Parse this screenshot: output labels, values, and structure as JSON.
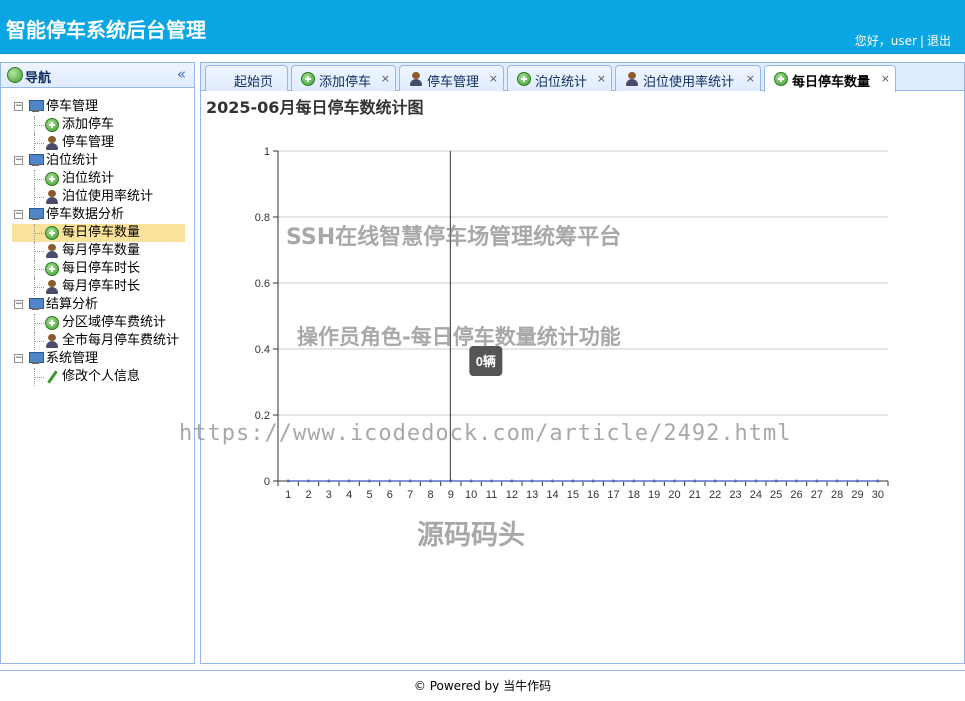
{
  "header": {
    "title": "智能停车系统后台管理",
    "greeting": "您好，user",
    "separator": "|",
    "logout": "退出"
  },
  "nav": {
    "title": "导航",
    "collapse": "«",
    "tree": [
      {
        "label": "停车管理",
        "icon": "computer-icon",
        "children": [
          {
            "label": "添加停车",
            "icon": "add-icon"
          },
          {
            "label": "停车管理",
            "icon": "user-icon"
          }
        ]
      },
      {
        "label": "泊位统计",
        "icon": "computer-icon",
        "children": [
          {
            "label": "泊位统计",
            "icon": "add-icon"
          },
          {
            "label": "泊位使用率统计",
            "icon": "user-icon"
          }
        ]
      },
      {
        "label": "停车数据分析",
        "icon": "computer-icon",
        "children": [
          {
            "label": "每日停车数量",
            "icon": "add-icon",
            "selected": true
          },
          {
            "label": "每月停车数量",
            "icon": "user-icon"
          },
          {
            "label": "每日停车时长",
            "icon": "add-icon"
          },
          {
            "label": "每月停车时长",
            "icon": "user-icon"
          }
        ]
      },
      {
        "label": "结算分析",
        "icon": "computer-icon",
        "children": [
          {
            "label": "分区域停车费统计",
            "icon": "add-icon"
          },
          {
            "label": "全市每月停车费统计",
            "icon": "user-icon"
          }
        ]
      },
      {
        "label": "系统管理",
        "icon": "computer-icon",
        "children": [
          {
            "label": "修改个人信息",
            "icon": "pencil-icon"
          }
        ]
      }
    ]
  },
  "tabs": [
    {
      "label": "起始页",
      "icon": "",
      "closable": false
    },
    {
      "label": "添加停车",
      "icon": "add-icon",
      "closable": true
    },
    {
      "label": "停车管理",
      "icon": "user-icon",
      "closable": true
    },
    {
      "label": "泊位统计",
      "icon": "add-icon",
      "closable": true
    },
    {
      "label": "泊位使用率统计",
      "icon": "user-icon",
      "closable": true
    },
    {
      "label": "每日停车数量",
      "icon": "add-icon",
      "closable": true,
      "active": true
    }
  ],
  "tab_close": "×",
  "chart": {
    "title": "2025-06月每日停车数统计图",
    "tooltip": "0辆"
  },
  "chart_data": {
    "type": "line",
    "title": "2025-06月每日停车数统计图",
    "xlabel": "",
    "ylabel": "",
    "x": [
      "1",
      "2",
      "3",
      "4",
      "5",
      "6",
      "7",
      "8",
      "9",
      "10",
      "11",
      "12",
      "13",
      "14",
      "15",
      "16",
      "17",
      "18",
      "19",
      "20",
      "21",
      "22",
      "23",
      "24",
      "25",
      "26",
      "27",
      "28",
      "29",
      "30"
    ],
    "series": [
      {
        "values": [
          0,
          0,
          0,
          0,
          0,
          0,
          0,
          0,
          0,
          0,
          0,
          0,
          0,
          0,
          0,
          0,
          0,
          0,
          0,
          0,
          0,
          0,
          0,
          0,
          0,
          0,
          0,
          0,
          0,
          0
        ]
      }
    ],
    "ylim": [
      0,
      1
    ],
    "yticks": [
      "0",
      "0.2",
      "0.4",
      "0.6",
      "0.8",
      "1"
    ],
    "grid": true,
    "hover_index": 8,
    "tooltip": "0辆"
  },
  "watermarks": {
    "line1": "SSH在线智慧停车场管理统筹平台",
    "line2": "操作员角色-每日停车数量统计功能",
    "line3": "https://www.icodedock.com/article/2492.html",
    "line4": "源码码头"
  },
  "footer": {
    "text": "© Powered by 当牛作码"
  },
  "colors": {
    "header_bg": "#0aa5e3",
    "panel_border": "#95b8e7",
    "selected_bg": "#fbe39b",
    "tooltip_bg": "#555555"
  }
}
